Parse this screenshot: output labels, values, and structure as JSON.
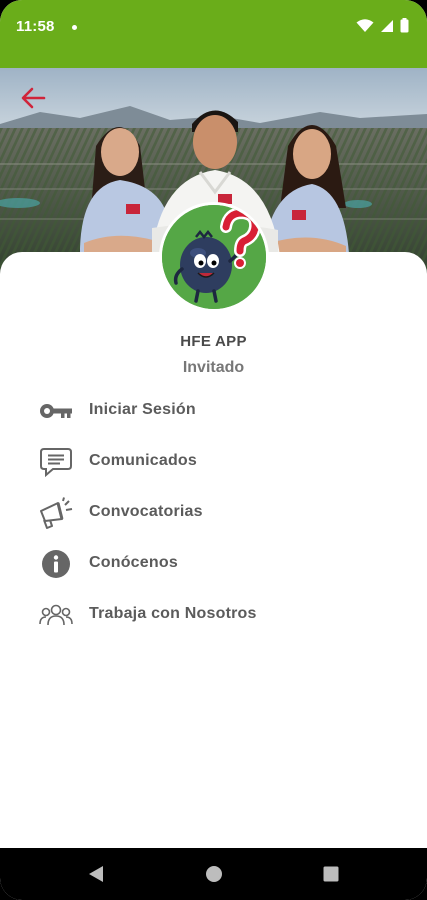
{
  "status_bar": {
    "time": "11:58",
    "icons": [
      "notification-dot",
      "wifi-icon",
      "signal-icon",
      "battery-icon"
    ],
    "background": "#6aad1a"
  },
  "header": {
    "back_icon": "arrow-left-icon",
    "back_color": "#d0243a"
  },
  "profile": {
    "app_name": "HFE APP",
    "role": "Invitado",
    "avatar_icon": "blueberry-mascot-question-icon"
  },
  "menu": {
    "items": [
      {
        "label": "Iniciar Sesión",
        "icon": "key-icon"
      },
      {
        "label": "Comunicados",
        "icon": "message-icon"
      },
      {
        "label": "Convocatorias",
        "icon": "megaphone-icon"
      },
      {
        "label": "Conócenos",
        "icon": "info-icon"
      },
      {
        "label": "Trabaja con Nosotros",
        "icon": "people-icon"
      }
    ]
  },
  "nav_bar": {
    "buttons": [
      "back-triangle-icon",
      "home-circle-icon",
      "recents-square-icon"
    ]
  }
}
